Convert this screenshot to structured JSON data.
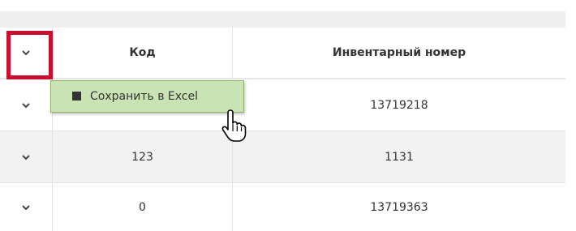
{
  "table": {
    "header": {
      "code": "Код",
      "inventory_number": "Инвентарный номер"
    },
    "rows": [
      {
        "code": "",
        "inventory_number": "13719218"
      },
      {
        "code": "123",
        "inventory_number": "1131"
      },
      {
        "code": "0",
        "inventory_number": "13719363"
      }
    ]
  },
  "context_menu": {
    "save_excel_label": "Сохранить в Excel"
  },
  "icons": {
    "expand": "chevron-down-icon",
    "excel": "excel-icon",
    "cursor": "hand-pointer-icon"
  },
  "colors": {
    "highlight": "#c8102e",
    "menu_bg": "#c9e3b4",
    "stripe": "#f2f2f2"
  }
}
